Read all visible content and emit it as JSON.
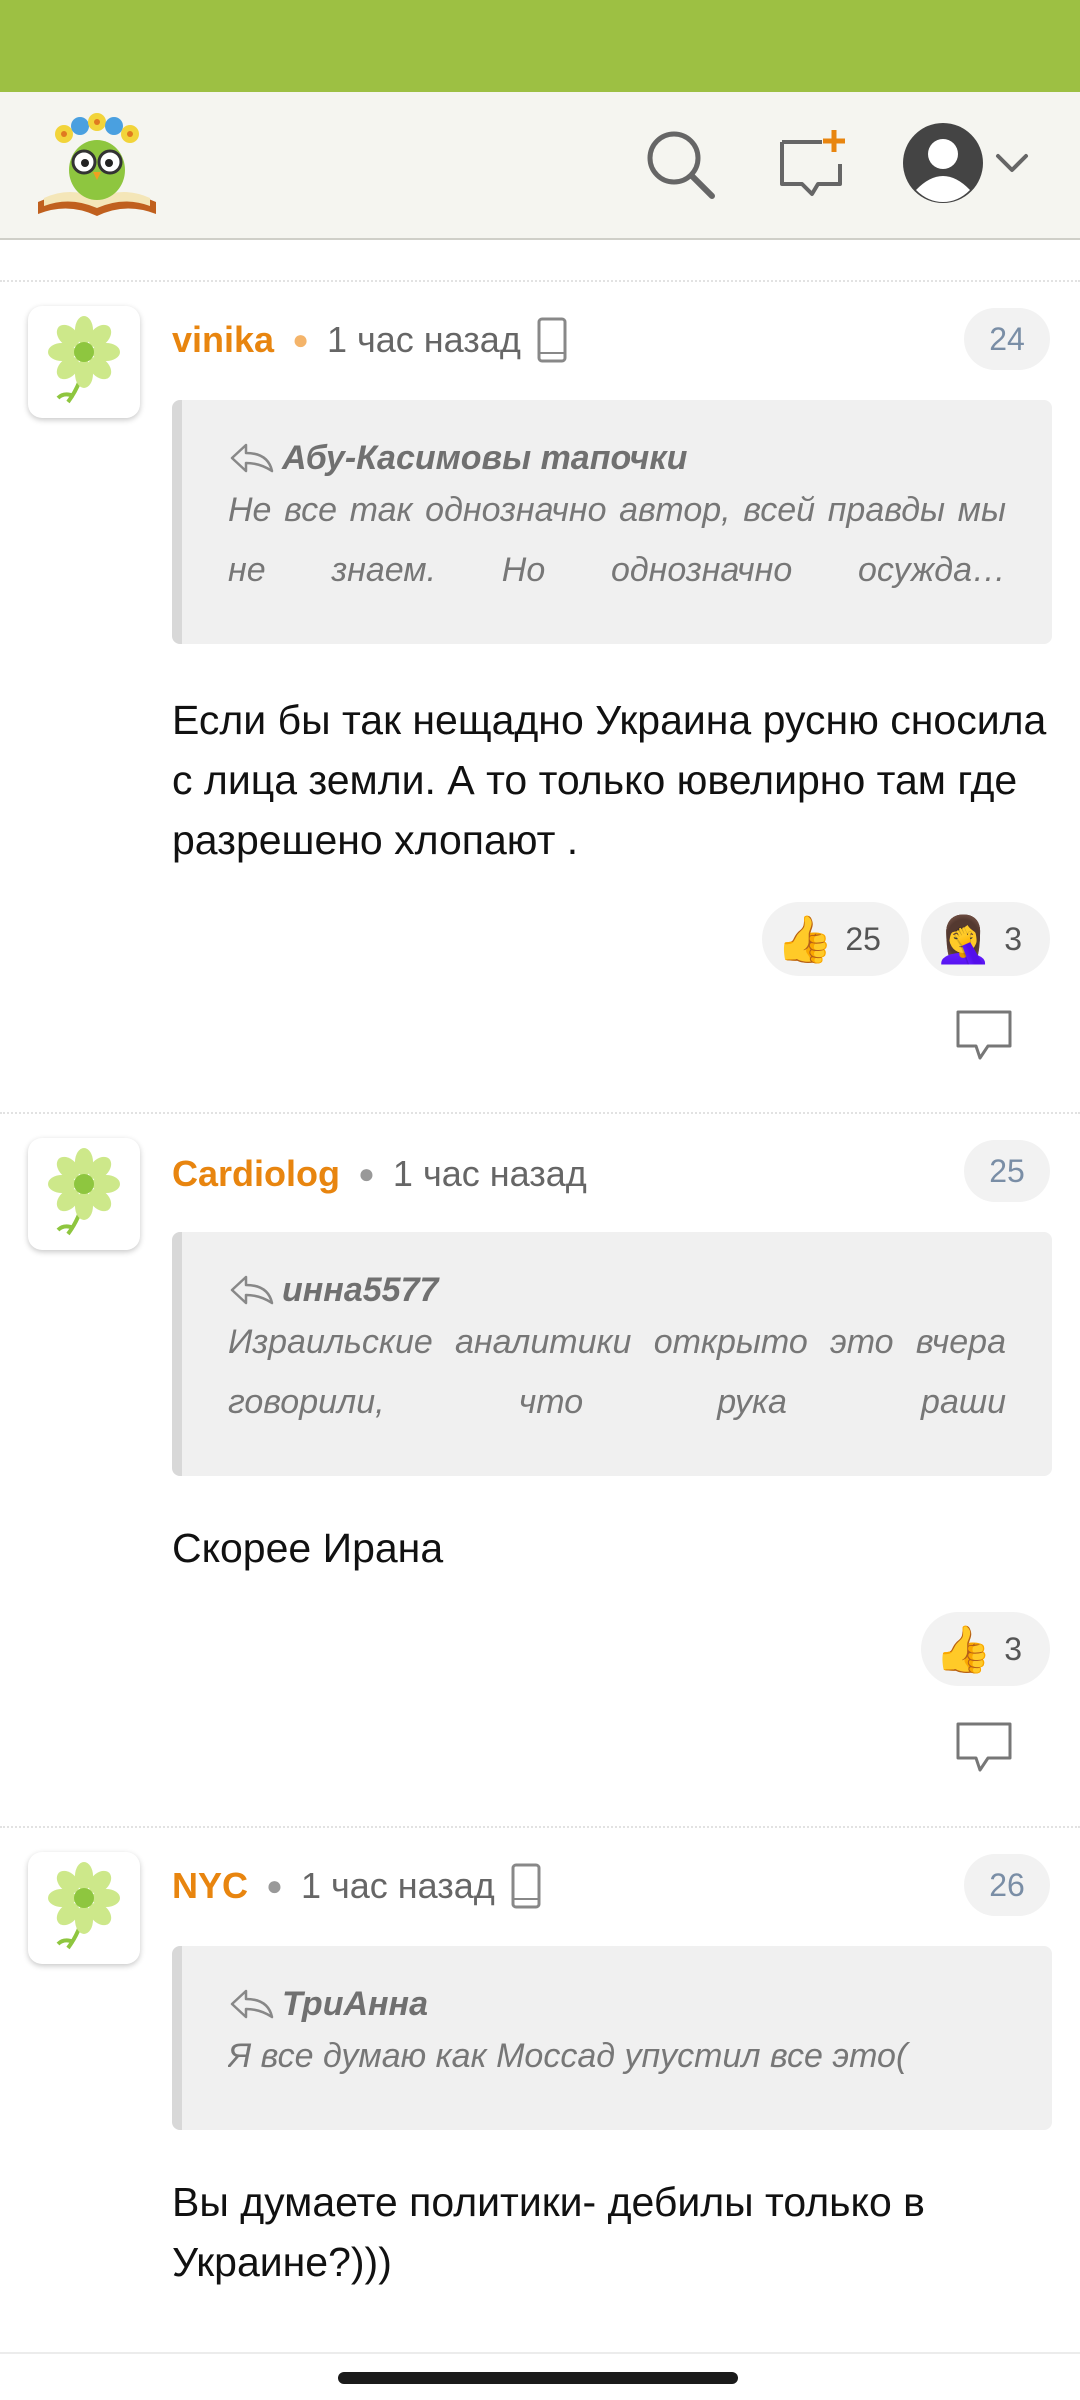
{
  "header": {
    "logo_icon": "owl-on-book-logo",
    "search_icon": "search-icon",
    "new_post_icon": "new-comment-icon",
    "avatar_icon": "user-avatar-icon",
    "chevron_icon": "chevron-down-icon"
  },
  "colors": {
    "status_bar": "#9dc043",
    "username": "#e8850f",
    "header_bg": "#f5f5f0"
  },
  "comments": [
    {
      "user": "vinika",
      "time": "1 час назад",
      "number": "24",
      "device_icon": "phone-icon",
      "quote_author": "Абу-Касимовы тапочки",
      "quote_text": "Не все так однозначно автор, всей правды мы не знаем. Но однозначно осужда…",
      "text": "Если бы так нещадно Украина русню сносила с лица земли. А то только ювелирно там где разрешено хлопают .",
      "reactions": [
        {
          "emoji": "👍",
          "count": "25"
        },
        {
          "emoji": "🤦‍♀️",
          "count": "3"
        }
      ]
    },
    {
      "user": "Cardiolog",
      "time": "1 час назад",
      "number": "25",
      "quote_author": "инна5577",
      "quote_text": "Израильские аналитики открыто это вчера говорили, что рука раши",
      "text": "Скорее Ирана",
      "reactions": [
        {
          "emoji": "👍",
          "count": "3"
        }
      ]
    },
    {
      "user": "NYC",
      "time": "1 час назад",
      "number": "26",
      "device_icon": "phone-icon",
      "quote_author": "ТриАнна",
      "quote_text": "Я все думаю как Моссад упустил все это(",
      "text": "Вы думаете политики- дебилы только в Украине?)))"
    }
  ]
}
